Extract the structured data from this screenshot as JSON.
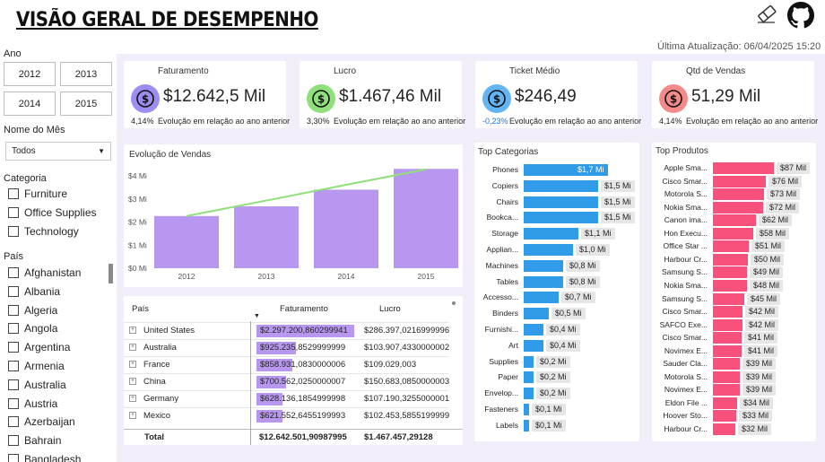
{
  "header": {
    "title": "VISÃO GERAL DE DESEMPENHO",
    "last_update": "Última Atualização: 06/04/2025 15:20"
  },
  "filters": {
    "year_label": "Ano",
    "years": [
      "2012",
      "2013",
      "2014",
      "2015"
    ],
    "month_label": "Nome do Mês",
    "month_value": "Todos",
    "category_label": "Categoria",
    "categories": [
      "Furniture",
      "Office Supplies",
      "Technology"
    ],
    "country_label": "País",
    "countries": [
      "Afghanistan",
      "Albania",
      "Algeria",
      "Angola",
      "Argentina",
      "Armenia",
      "Australia",
      "Austria",
      "Azerbaijan",
      "Bahrain",
      "Bangladesh"
    ]
  },
  "kpis": [
    {
      "title": "Faturamento",
      "value": "$12.642,5 Mil",
      "pct": "4,14%",
      "pct_color": "#252423",
      "desc": "Evolução em relação ao ano anterior",
      "icon": "piggy-bank-icon",
      "icon_color": "#9d8df1"
    },
    {
      "title": "Lucro",
      "value": "$1.467,46 Mil",
      "pct": "3,30%",
      "pct_color": "#252423",
      "desc": "Evolução em relação ao ano anterior",
      "icon": "money-hand-icon",
      "icon_color": "#8fe07a"
    },
    {
      "title": "Ticket Médio",
      "value": "$246,49",
      "pct": "-0,23%",
      "pct_color": "#1a73e8",
      "desc": "Evolução em relação ao ano anterior",
      "icon": "ticket-icon",
      "icon_color": "#64b5f6"
    },
    {
      "title": "Qtd de Vendas",
      "value": "51,29 Mil",
      "pct": "4,14%",
      "pct_color": "#252423",
      "desc": "Evolução em relação ao ano anterior",
      "icon": "coin-icon",
      "icon_color": "#f48a8a"
    }
  ],
  "sales_chart": {
    "title": "Evolução de Vendas",
    "bar_color": "#b797ef",
    "line_color": "#8fe07a"
  },
  "chart_data": [
    {
      "type": "bar",
      "title": "Evolução de Vendas",
      "categories": [
        "2012",
        "2013",
        "2014",
        "2015"
      ],
      "values": [
        2.26,
        2.68,
        3.4,
        4.3
      ],
      "trend": [
        2.26,
        2.93,
        3.61,
        4.28
      ],
      "ylim": [
        0,
        4
      ],
      "yticks": [
        "$0 Mi",
        "$1 Mi",
        "$2 Mi",
        "$3 Mi",
        "$4 Mi"
      ]
    },
    {
      "type": "bar",
      "title": "Top Categorias",
      "categories": [
        "Phones",
        "Copiers",
        "Chairs",
        "Bookca...",
        "Storage",
        "Applian...",
        "Machines",
        "Tables",
        "Accesso...",
        "Binders",
        "Furnishi...",
        "Art",
        "Supplies",
        "Paper",
        "Envelop...",
        "Fasteners",
        "Labels"
      ],
      "values": [
        1.7,
        1.5,
        1.5,
        1.5,
        1.1,
        1.0,
        0.8,
        0.8,
        0.7,
        0.5,
        0.4,
        0.4,
        0.2,
        0.2,
        0.2,
        0.1,
        0.1
      ],
      "labels": [
        "$1,7 Mi",
        "$1,5 Mi",
        "$1,5 Mi",
        "$1,5 Mi",
        "$1,1 Mi",
        "$1,0 Mi",
        "$0,8 Mi",
        "$0,8 Mi",
        "$0,7 Mi",
        "$0,5 Mi",
        "$0,4 Mi",
        "$0,4 Mi",
        "$0,2 Mi",
        "$0,2 Mi",
        "$0,2 Mi",
        "$0,1 Mi",
        "$0,1 Mi"
      ],
      "color": "#2f9be9"
    },
    {
      "type": "bar",
      "title": "Top Produtos",
      "categories": [
        "Apple Sma...",
        "Cisco Smar...",
        "Motorola S...",
        "Nokia Sma...",
        "Canon ima...",
        "Hon Execu...",
        "Office Star ...",
        "Harbour Cr...",
        "Samsung S...",
        "Nokia Sma...",
        "Samsung S...",
        "Cisco Smar...",
        "SAFCO Exe...",
        "Cisco Smar...",
        "Novimex E...",
        "Sauder Cla...",
        "Motorola S...",
        "Novimex E...",
        "Eldon File ...",
        "Hoover Sto...",
        "Harbour Cr..."
      ],
      "values": [
        87,
        76,
        73,
        72,
        62,
        58,
        51,
        50,
        49,
        48,
        45,
        42,
        42,
        41,
        41,
        39,
        39,
        39,
        34,
        33,
        32
      ],
      "labels": [
        "$87 Mil",
        "$76 Mil",
        "$73 Mil",
        "$72 Mil",
        "$62 Mil",
        "$58 Mil",
        "$51 Mil",
        "$50 Mil",
        "$49 Mil",
        "$48 Mil",
        "$45 Mil",
        "$42 Mil",
        "$42 Mil",
        "$41 Mil",
        "$41 Mil",
        "$39 Mil",
        "$39 Mil",
        "$39 Mil",
        "$34 Mil",
        "$33 Mil",
        "$32 Mil"
      ],
      "color": "#f7517c"
    }
  ],
  "table": {
    "columns": [
      "País",
      "Faturamento",
      "Lucro"
    ],
    "rows": [
      {
        "country": "United States",
        "faturamento": "$2.297.200,860299941",
        "lucro": "$286.397,0216999996",
        "share": 1.0
      },
      {
        "country": "Australia",
        "faturamento": "$925.235,8529999999",
        "lucro": "$103.907,4330000002",
        "share": 0.4
      },
      {
        "country": "France",
        "faturamento": "$858.931,0830000006",
        "lucro": "$109.029,003",
        "share": 0.37
      },
      {
        "country": "China",
        "faturamento": "$700.562,0250000007",
        "lucro": "$150.683,0850000003",
        "share": 0.3
      },
      {
        "country": "Germany",
        "faturamento": "$628.136,1854999998",
        "lucro": "$107.190,3255000001",
        "share": 0.27
      },
      {
        "country": "Mexico",
        "faturamento": "$621.552,6455199993",
        "lucro": "$102.453,5855199999",
        "share": 0.27
      }
    ],
    "total_label": "Total",
    "total_faturamento": "$12.642.501,90987995",
    "total_lucro": "$1.467.457,29128"
  },
  "top_categories_title": "Top Categorias",
  "top_products_title": "Top Produtos"
}
